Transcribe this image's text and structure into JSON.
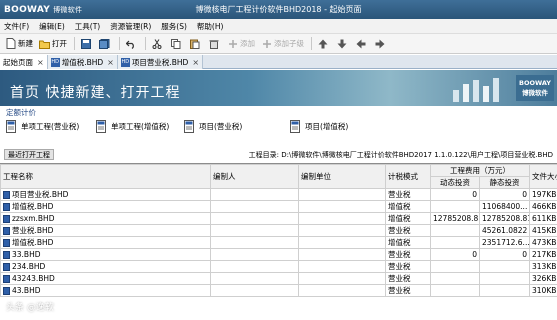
{
  "window": {
    "brand": "BOOWAY",
    "brand_cn": "博微软件",
    "title": "博微核电厂工程计价软件BHD2018 - 起始页面"
  },
  "menu": [
    "文件(F)",
    "编辑(E)",
    "工具(T)",
    "资源管理(R)",
    "服务(S)",
    "帮助(H)"
  ],
  "toolbar": {
    "new": "新建",
    "open": "打开",
    "add": "添加",
    "add_child": "添加子级"
  },
  "tabs": [
    {
      "label": "起始页面",
      "icon": "none"
    },
    {
      "label": "增值税.BHD",
      "icon": "file-icon"
    },
    {
      "label": "项目营业税.BHD",
      "icon": "file-icon"
    }
  ],
  "banner": {
    "slogan": "首页  快捷新建、打开工程",
    "brand_top": "BOOWAY",
    "brand_bottom": "博微软件"
  },
  "quick": {
    "title": "定额计价",
    "items": [
      "单项工程(营业税)",
      "单项工程(增值税)",
      "项目(营业税)",
      "项目(增值税)"
    ]
  },
  "recent": {
    "button": "最近打开工程",
    "dir": "工程目录: D:\\博微软件\\博微核电厂工程计价软件BHD2017 1.1.0.122\\用户工程\\项目营业税.BHD"
  },
  "table": {
    "headers": {
      "name": "工程名称",
      "editor": "编制人",
      "unit": "编制单位",
      "mode": "计税模式",
      "cost_group": "工程费用（万元）",
      "dynamic": "动态投资",
      "static": "静态投资",
      "size": "文件大小"
    },
    "rows": [
      {
        "name": "项目营业税.BHD",
        "editor": "",
        "unit": "",
        "mode": "营业税",
        "dynamic": "0",
        "static": "0",
        "size": "197KB"
      },
      {
        "name": "增值税.BHD",
        "editor": "",
        "unit": "",
        "mode": "增值税",
        "dynamic": "",
        "static": "11068400...",
        "size": "466KB"
      },
      {
        "name": "zzsxm.BHD",
        "editor": "",
        "unit": "",
        "mode": "增值税",
        "dynamic": "12785208.81",
        "static": "12785208.81",
        "size": "611KB"
      },
      {
        "name": "营业税.BHD",
        "editor": "",
        "unit": "",
        "mode": "营业税",
        "dynamic": "",
        "static": "45261.0822",
        "size": "415KB"
      },
      {
        "name": "增值税.BHD",
        "editor": "",
        "unit": "",
        "mode": "增值税",
        "dynamic": "",
        "static": "2351712.6...",
        "size": "473KB"
      },
      {
        "name": "33.BHD",
        "editor": "",
        "unit": "",
        "mode": "营业税",
        "dynamic": "0",
        "static": "0",
        "size": "217KB"
      },
      {
        "name": "234.BHD",
        "editor": "",
        "unit": "",
        "mode": "营业税",
        "dynamic": "",
        "static": "",
        "size": "313KB"
      },
      {
        "name": "43243.BHD",
        "editor": "",
        "unit": "",
        "mode": "营业税",
        "dynamic": "",
        "static": "",
        "size": "326KB"
      },
      {
        "name": "43.BHD",
        "editor": "",
        "unit": "",
        "mode": "营业税",
        "dynamic": "",
        "static": "",
        "size": "310KB"
      }
    ]
  },
  "watermark": "头条 @逸软"
}
